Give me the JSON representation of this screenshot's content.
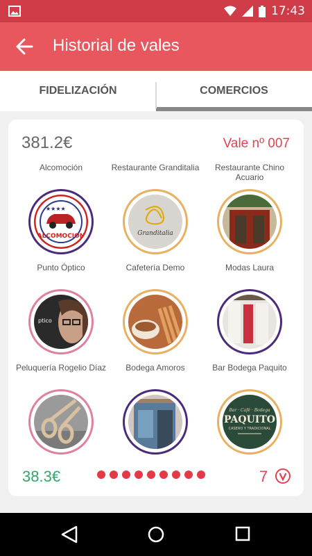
{
  "status_bar": {
    "time": "17:43"
  },
  "app_bar": {
    "title": "Historial de vales"
  },
  "tabs": [
    {
      "label": "FIDELIZACIÓN"
    },
    {
      "label": "COMERCIOS"
    }
  ],
  "card": {
    "total": "381.2€",
    "voucher": "Vale nº 007",
    "remaining": "38.3€",
    "count": "7",
    "dots": 9,
    "shops": [
      {
        "name": "Alcomoción",
        "logo_text": "ALCOMOCION"
      },
      {
        "name": "Restaurante Granditalia",
        "logo_text": "Granditalia"
      },
      {
        "name": "Restaurante Chino Acuario"
      },
      {
        "name": "Punto Óptico",
        "logo_text": "ptico"
      },
      {
        "name": "Cafetería Demo"
      },
      {
        "name": "Modas Laura"
      },
      {
        "name": "Peluquería Rogelio Díaz"
      },
      {
        "name": "Bodega Amoros"
      },
      {
        "name": "Bar Bodega Paquito",
        "logo_top": "Bar · Café · Bodega",
        "logo_text": "PAQUITO",
        "logo_sub": "CASERO Y TRADICIONAL"
      }
    ]
  },
  "colors": {
    "accent": "#e8575e",
    "status": "#cf3c47",
    "red": "#e53945",
    "green": "#2fa86a"
  }
}
